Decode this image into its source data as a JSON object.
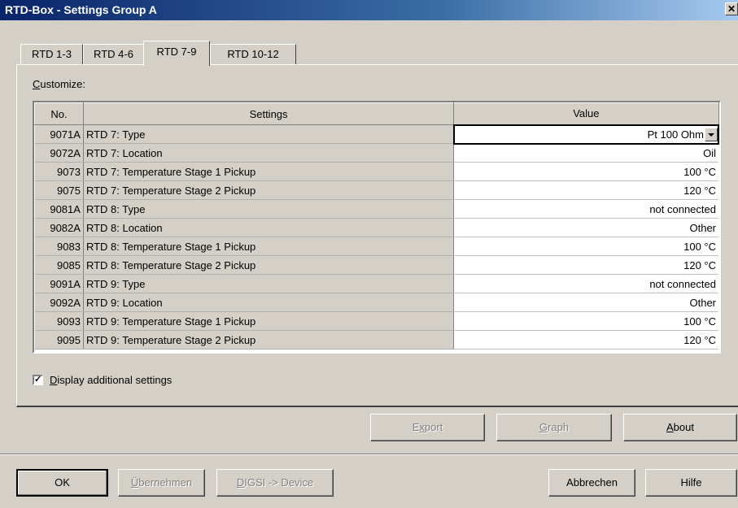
{
  "window": {
    "title": "RTD-Box - Settings Group A",
    "close_label": "✕"
  },
  "tabs": [
    {
      "label": "RTD 1-3",
      "active": false
    },
    {
      "label": "RTD 4-6",
      "active": false
    },
    {
      "label": "RTD 7-9",
      "active": true
    },
    {
      "label": "RTD 10-12",
      "active": false
    }
  ],
  "customize": {
    "label_first": "C",
    "label_rest": "ustomize:"
  },
  "table": {
    "headers": {
      "no": "No.",
      "settings": "Settings",
      "value": "Value"
    },
    "rows": [
      {
        "no": "9071A",
        "setting": "RTD 7: Type",
        "value": "Pt 100 Ohm",
        "dropdown": true
      },
      {
        "no": "9072A",
        "setting": "RTD 7: Location",
        "value": "Oil"
      },
      {
        "no": "9073",
        "setting": "RTD 7: Temperature Stage 1 Pickup",
        "value": "100 °C"
      },
      {
        "no": "9075",
        "setting": "RTD 7: Temperature Stage 2 Pickup",
        "value": "120 °C"
      },
      {
        "no": "9081A",
        "setting": "RTD 8: Type",
        "value": "not connected"
      },
      {
        "no": "9082A",
        "setting": "RTD 8: Location",
        "value": "Other"
      },
      {
        "no": "9083",
        "setting": "RTD 8: Temperature Stage 1 Pickup",
        "value": "100 °C"
      },
      {
        "no": "9085",
        "setting": "RTD 8: Temperature Stage 2 Pickup",
        "value": "120 °C"
      },
      {
        "no": "9091A",
        "setting": "RTD 9: Type",
        "value": "not connected"
      },
      {
        "no": "9092A",
        "setting": "RTD 9: Location",
        "value": "Other"
      },
      {
        "no": "9093",
        "setting": "RTD 9: Temperature Stage 1 Pickup",
        "value": "100 °C"
      },
      {
        "no": "9095",
        "setting": "RTD 9: Temperature Stage 2 Pickup",
        "value": "120 °C"
      }
    ]
  },
  "display_additional": {
    "checked": true,
    "label_first": "D",
    "label_rest": "isplay additional settings"
  },
  "mid_buttons": {
    "export": {
      "a": "E",
      "u": "x",
      "b": "port",
      "enabled": false
    },
    "graph": {
      "a": "",
      "u": "G",
      "b": "raph",
      "enabled": false
    },
    "about": {
      "a": "",
      "u": "A",
      "b": "bout",
      "enabled": true
    }
  },
  "bottom_buttons": {
    "ok": "OK",
    "apply": {
      "a": "",
      "u": "Ü",
      "b": "bernehmen",
      "enabled": false
    },
    "digsi": {
      "a": "",
      "u": "D",
      "b": "IGSI -> Device",
      "enabled": false
    },
    "cancel": "Abbrechen",
    "help": "Hilfe"
  }
}
